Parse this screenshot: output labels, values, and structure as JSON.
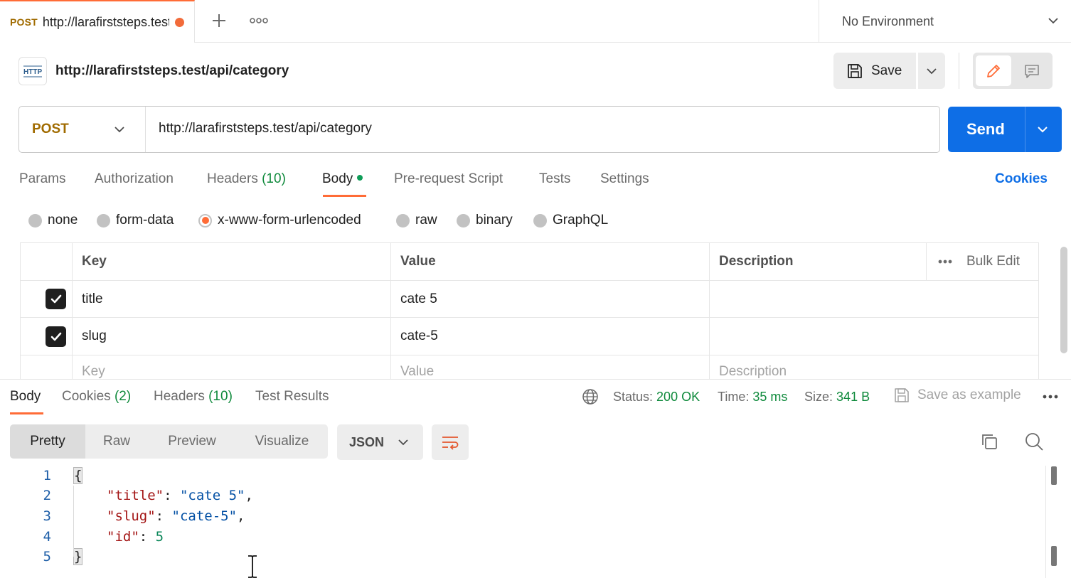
{
  "tabbar": {
    "active_tab": {
      "method": "POST",
      "url": "http://larafirststeps.test/api/category",
      "unsaved": true
    },
    "new_tab_icon": "plus-icon",
    "more_icon": "ellipsis-icon",
    "environment": "No Environment"
  },
  "request": {
    "badge_icon": "http-icon",
    "title": "http://larafirststeps.test/api/category",
    "save_label": "Save",
    "method": "POST",
    "url": "http://larafirststeps.test/api/category",
    "send_label": "Send"
  },
  "request_tabs": [
    {
      "label": "Params",
      "count": ""
    },
    {
      "label": "Authorization",
      "count": ""
    },
    {
      "label": "Headers",
      "count": "(10)"
    },
    {
      "label": "Body",
      "count": ""
    },
    {
      "label": "Pre-request Script",
      "count": ""
    },
    {
      "label": "Tests",
      "count": ""
    },
    {
      "label": "Settings",
      "count": ""
    }
  ],
  "cookies_link": "Cookies",
  "body_types": {
    "options": [
      "none",
      "form-data",
      "x-www-form-urlencoded",
      "raw",
      "binary",
      "GraphQL"
    ],
    "selected": "x-www-form-urlencoded"
  },
  "kv_table": {
    "headers": {
      "key": "Key",
      "value": "Value",
      "description": "Description",
      "bulk_edit": "Bulk Edit"
    },
    "rows": [
      {
        "checked": true,
        "key": "title",
        "value": "cate 5",
        "description": ""
      },
      {
        "checked": true,
        "key": "slug",
        "value": "cate-5",
        "description": ""
      }
    ],
    "placeholders": {
      "key": "Key",
      "value": "Value",
      "description": "Description"
    }
  },
  "response": {
    "tabs": [
      {
        "label": "Body",
        "count": ""
      },
      {
        "label": "Cookies",
        "count": "(2)"
      },
      {
        "label": "Headers",
        "count": "(10)"
      },
      {
        "label": "Test Results",
        "count": ""
      }
    ],
    "status_label": "Status:",
    "status_value": "200 OK",
    "time_label": "Time:",
    "time_value": "35 ms",
    "size_label": "Size:",
    "size_value": "341 B",
    "save_example": "Save as example",
    "views": [
      "Pretty",
      "Raw",
      "Preview",
      "Visualize"
    ],
    "format": "JSON",
    "code_lines": [
      "1",
      "2",
      "3",
      "4",
      "5"
    ],
    "json": {
      "open": "{",
      "close": "}",
      "pairs": [
        {
          "key": "\"title\"",
          "value": "\"cate 5\"",
          "comma": ","
        },
        {
          "key": "\"slug\"",
          "value": "\"cate-5\"",
          "comma": ","
        },
        {
          "key": "\"id\"",
          "value": "5",
          "comma": ""
        }
      ]
    }
  },
  "colors": {
    "accent": "#ff6c37",
    "send": "#0e6ee6",
    "method": "#a06b00",
    "count": "#0f8a3c"
  }
}
